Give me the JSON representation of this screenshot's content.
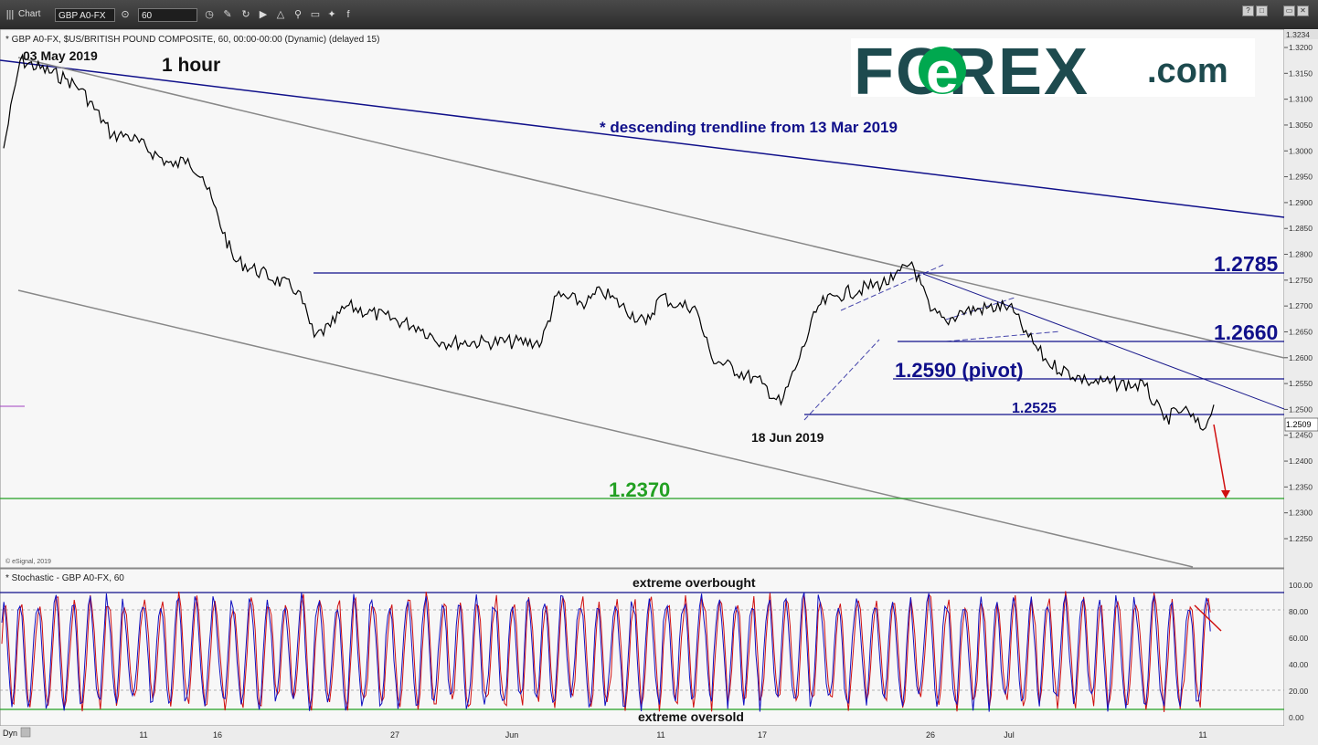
{
  "toolbar": {
    "app_label": "Chart",
    "symbol": "GBP A0-FX",
    "interval": "60",
    "window_buttons": [
      "?",
      "□",
      "▭",
      "✕"
    ]
  },
  "header": {
    "title": "* GBP A0-FX, $US/BRITISH POUND COMPOSITE, 60, 00:00-00:00 (Dynamic) (delayed 15)",
    "copyright": "© eSignal, 2019"
  },
  "brand": {
    "logo_text": "FOREX",
    "logo_suffix": ".com",
    "logo_color": "#1d4a4e",
    "accent_color": "#00a84f"
  },
  "annotations": {
    "start_date": "03 May 2019",
    "timeframe": "1 hour",
    "trendline_note": "* descending trendline from 13 Mar 2019",
    "low_date": "18 Jun 2019",
    "level_1": "1.2785",
    "level_2": "1.2660",
    "level_pivot": "1.2590 (pivot)",
    "level_3": "1.2525",
    "target": "1.2370"
  },
  "stochastic": {
    "title": "* Stochastic - GBP A0-FX, 60",
    "overbought_label": "extreme overbought",
    "oversold_label": "extreme oversold",
    "y_ticks": [
      "100.00",
      "80.00",
      "60.00",
      "40.00",
      "20.00",
      "0.00"
    ],
    "k_color": "#1010c0",
    "d_color": "#d01010"
  },
  "x_axis": {
    "corner_label": "Dyn",
    "tick_labels": [
      "11",
      "16",
      "27",
      "Jun",
      "11",
      "17",
      "26",
      "Jul",
      "11"
    ]
  },
  "chart_data": {
    "type": "candlestick",
    "instrument": "GBP A0-FX",
    "interval": "60",
    "last_price": "1.2509",
    "top_price": "1.3234",
    "y_ticks": [
      "1.3200",
      "1.3150",
      "1.3100",
      "1.3050",
      "1.3000",
      "1.2950",
      "1.2900",
      "1.2850",
      "1.2800",
      "1.2750",
      "1.2700",
      "1.2650",
      "1.2600",
      "1.2550",
      "1.2500",
      "1.2450",
      "1.2400",
      "1.2350",
      "1.2300",
      "1.2250"
    ],
    "ylim": [
      1.2232,
      1.3245
    ],
    "path": [
      [
        "03 May 2019",
        1.3005
      ],
      [
        "03 May 2019",
        1.3175
      ],
      [
        "06 May 2019",
        1.314
      ],
      [
        "07 May 2019",
        1.312
      ],
      [
        "09 May 2019",
        1.303
      ],
      [
        "10 May 2019",
        1.303
      ],
      [
        "13 May 2019",
        1.297
      ],
      [
        "14 May 2019",
        1.2985
      ],
      [
        "15 May 2019",
        1.295
      ],
      [
        "17 May 2019",
        1.279
      ],
      [
        "21 May 2019",
        1.273
      ],
      [
        "22 May 2019",
        1.264
      ],
      [
        "23 May 2019",
        1.266
      ],
      [
        "24 May 2019",
        1.27
      ],
      [
        "28 May 2019",
        1.266
      ],
      [
        "29 May 2019",
        1.263
      ],
      [
        "31 May 2019",
        1.263
      ],
      [
        "03 Jun 2019",
        1.263
      ],
      [
        "04 Jun 2019",
        1.272
      ],
      [
        "06 Jun 2019",
        1.2705
      ],
      [
        "07 Jun 2019",
        1.273
      ],
      [
        "10 Jun 2019",
        1.2665
      ],
      [
        "11 Jun 2019",
        1.272
      ],
      [
        "12 Jun 2019",
        1.27
      ],
      [
        "13 Jun 2019",
        1.27
      ],
      [
        "14 Jun 2019",
        1.26
      ],
      [
        "17 Jun 2019",
        1.255
      ],
      [
        "18 Jun 2019",
        1.251
      ],
      [
        "19 Jun 2019",
        1.26
      ],
      [
        "20 Jun 2019",
        1.27
      ],
      [
        "21 Jun 2019",
        1.272
      ],
      [
        "24 Jun 2019",
        1.275
      ],
      [
        "25 Jun 2019",
        1.2785
      ],
      [
        "26 Jun 2019",
        1.269
      ],
      [
        "27 Jun 2019",
        1.267
      ],
      [
        "28 Jun 2019",
        1.269
      ],
      [
        "01 Jul 2019",
        1.27
      ],
      [
        "02 Jul 2019",
        1.264
      ],
      [
        "03 Jul 2019",
        1.259
      ],
      [
        "05 Jul 2019",
        1.2555
      ],
      [
        "08 Jul 2019",
        1.2545
      ],
      [
        "09 Jul 2019",
        1.248
      ],
      [
        "10 Jul 2019",
        1.25
      ],
      [
        "11 Jul 2019",
        1.246
      ],
      [
        "12 Jul 2019",
        1.248
      ],
      [
        "13 Jul 2019",
        1.2509
      ]
    ],
    "horizontal_levels": [
      1.2785,
      1.266,
      1.259,
      1.2525,
      1.237
    ],
    "projection": {
      "from": 1.2509,
      "to": 1.237
    },
    "stochastic_bounds": {
      "overbought": 95,
      "oversold": 5,
      "guides": [
        80,
        20
      ]
    }
  }
}
